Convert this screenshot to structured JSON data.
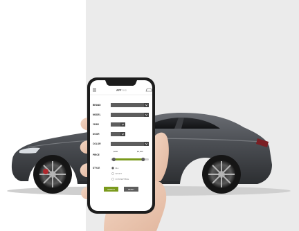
{
  "app": {
    "title": "APP",
    "title_suffix": "FIND",
    "menu_icon": "hamburger-icon",
    "profile_icon": "car-outline-icon"
  },
  "filters": [
    {
      "label": "BRAND"
    },
    {
      "label": "MODEL"
    },
    {
      "label": "YEAR"
    },
    {
      "label": "DOOR"
    },
    {
      "label": "COLOR"
    }
  ],
  "price": {
    "label": "PRICE",
    "min_label": "$200",
    "max_label": "$2,000",
    "range_fraction": [
      0.08,
      0.85
    ]
  },
  "style": {
    "label": "STYLE",
    "options": [
      "ALL",
      "SPORT",
      "CONVERTIBLE"
    ],
    "selected_index": 0
  },
  "buttons": {
    "search_label": "SEARCH",
    "reset_label": "RESET"
  },
  "colors": {
    "accent_green": "#7a9a1c",
    "control_dark": "#5d5d5d",
    "car_body": "#4a4d52"
  }
}
